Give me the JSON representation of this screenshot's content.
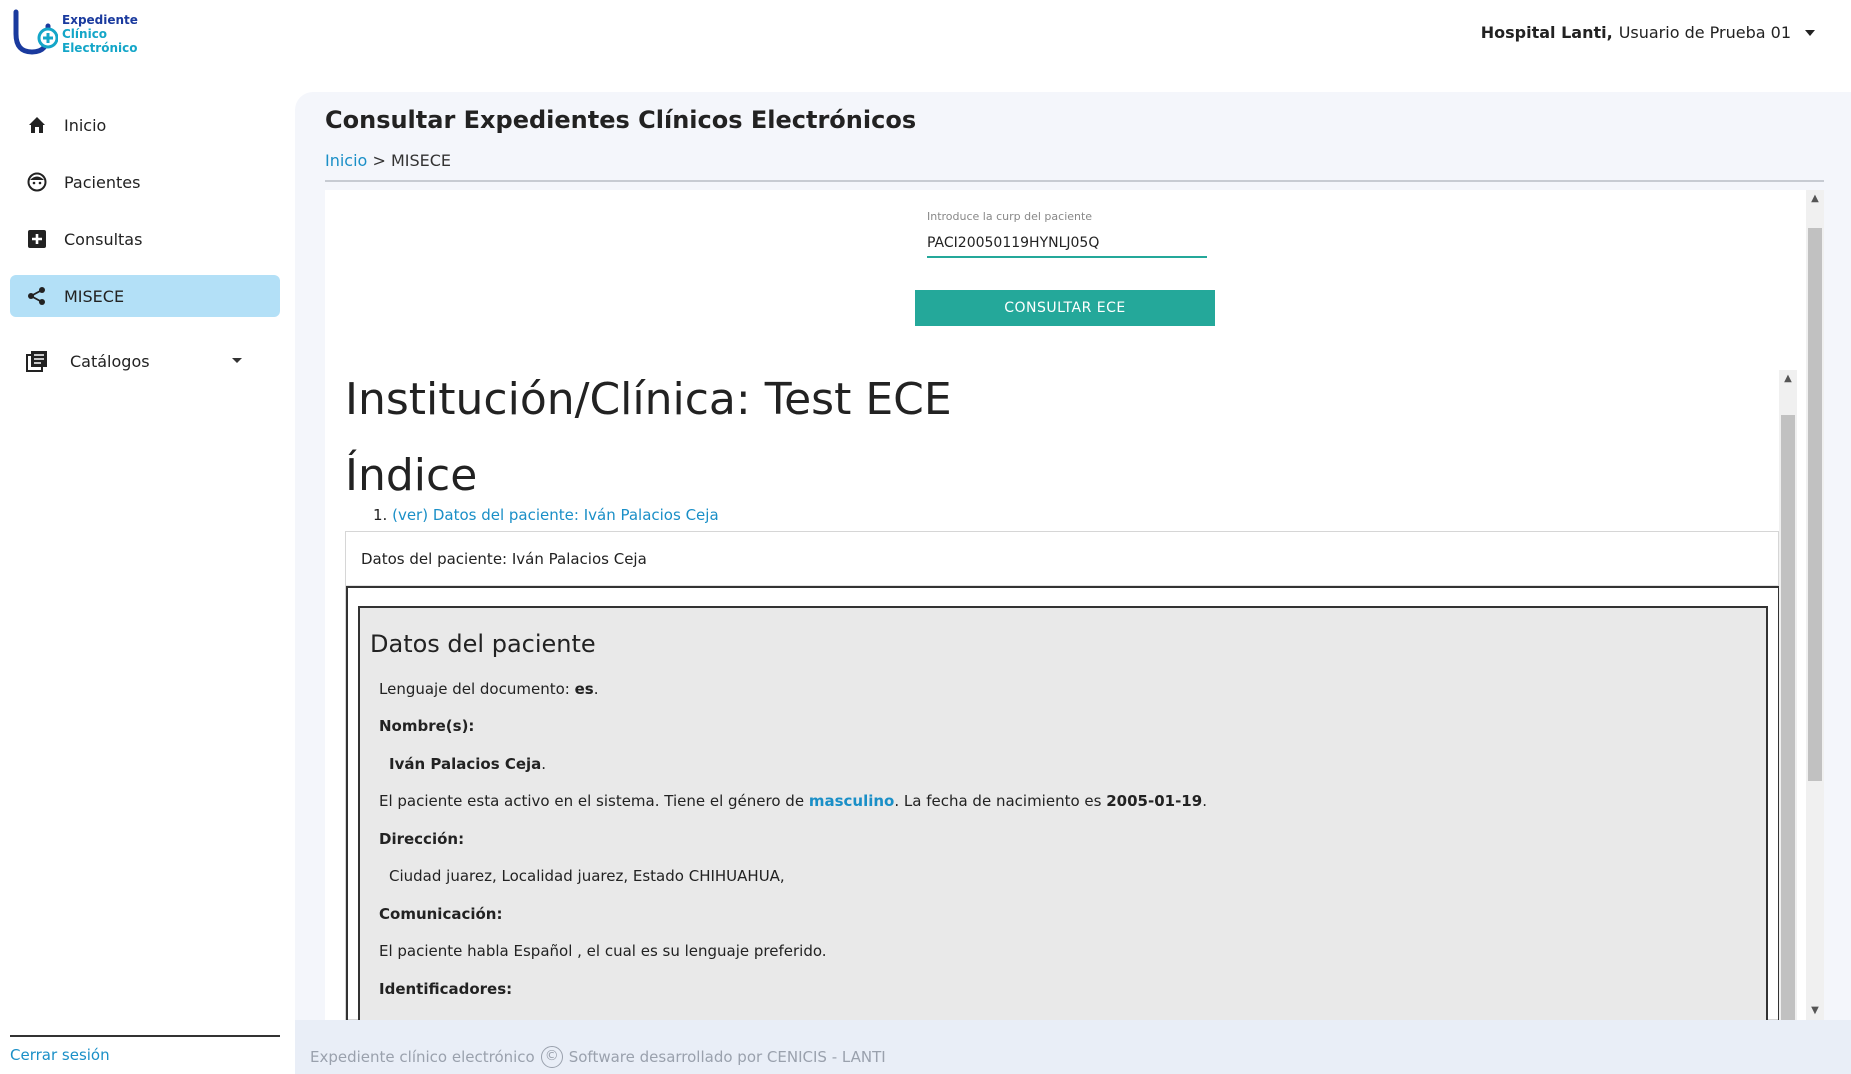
{
  "logo": {
    "line1": "Expediente",
    "line2": "Clínico",
    "line3": "Electrónico"
  },
  "user": {
    "hospital": "Hospital Lanti,",
    "name": "Usuario de Prueba 01"
  },
  "sidebar": {
    "items": [
      {
        "label": "Inicio",
        "icon": "home-icon",
        "active": false
      },
      {
        "label": "Pacientes",
        "icon": "patient-face-icon",
        "active": false
      },
      {
        "label": "Consultas",
        "icon": "medical-plus-icon",
        "active": false
      },
      {
        "label": "MISECE",
        "icon": "share-icon",
        "active": true
      }
    ],
    "catalog_label": "Catálogos",
    "logout_label": "Cerrar sesión"
  },
  "main": {
    "title": "Consultar Expedientes Clínicos Electrónicos",
    "breadcrumb_home": "Inicio",
    "breadcrumb_sep": ">",
    "breadcrumb_current": "MISECE",
    "curp_label": "Introduce la curp del paciente",
    "curp_value": "PACI20050119HYNLJ05Q",
    "consult_button": "CONSULTAR ECE"
  },
  "document": {
    "institution_title": "Institución/Clínica: Test ECE",
    "index_title": "Índice",
    "index_items": [
      {
        "number": "1.",
        "link": "(ver) Datos del paciente: Iván Palacios Ceja"
      }
    ],
    "section_header": "Datos del paciente: Iván Palacios Ceja",
    "section_title": "Datos del paciente",
    "language_label": "Lenguaje del documento:",
    "language_value": "es",
    "names_label": "Nombre(s):",
    "names_value": "Iván Palacios Ceja",
    "status_text_1": "El paciente esta activo en el sistema. Tiene el género de",
    "gender": "masculino",
    "status_text_2": ". La fecha de nacimiento es",
    "birthdate": "2005-01-19",
    "address_label": "Dirección:",
    "address_value": "Ciudad juarez, Localidad juarez, Estado CHIHUAHUA,",
    "communication_label": "Comunicación:",
    "communication_value": "El paciente habla Español , el cual es su lenguaje preferido.",
    "identifiers_label": "Identificadores:"
  },
  "footer": {
    "left": "Expediente clínico electrónico",
    "copyright": "©",
    "right": "Software desarrollado por CENICIS - LANTI"
  },
  "colors": {
    "accent": "#24a89a",
    "link": "#1a8fc7",
    "active_nav": "#b3e0f7"
  }
}
